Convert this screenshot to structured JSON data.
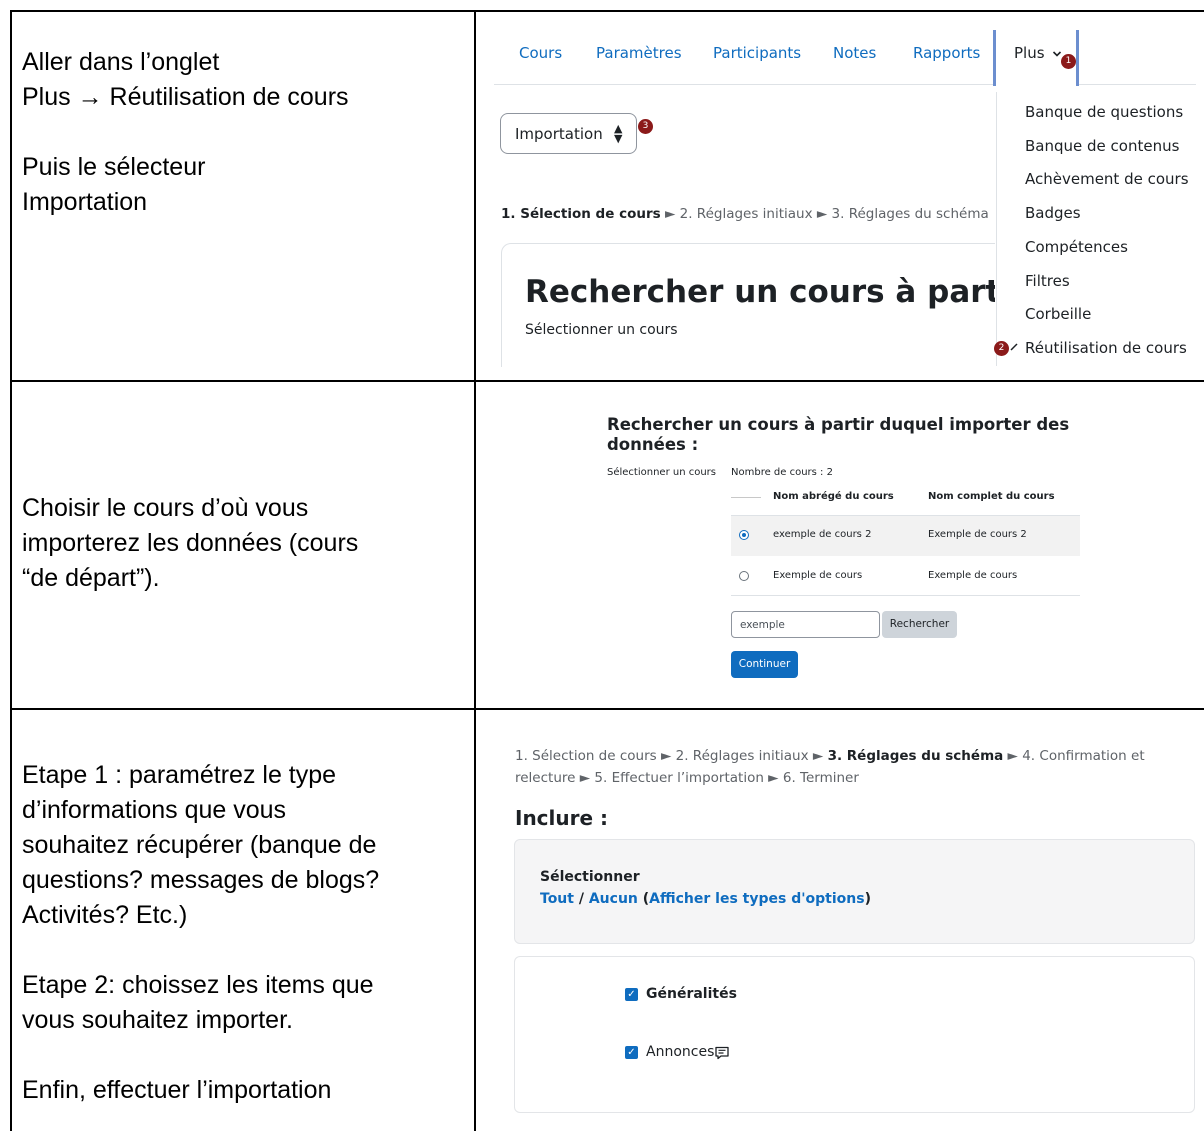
{
  "rows": [
    {
      "text": "Aller dans l’onglet\nPlus → Réutilisation de cours\n\nPuis le sélecteur\nImportation"
    },
    {
      "text": "Choisir le cours d’où vous\nimporterez les données (cours\n“de départ”)."
    },
    {
      "text": "Etape 1 : paramétrez le type\nd’informations que vous\nsouhaitez récupérer (banque de\nquestions? messages de blogs?\nActivités? Etc.)\n\nEtape 2: choissez les items que\nvous souhaitez importer.\n\nEnfin, effectuer l’importation"
    }
  ],
  "nav": {
    "tabs": [
      "Cours",
      "Paramètres",
      "Participants",
      "Notes",
      "Rapports"
    ],
    "more_label": "Plus",
    "more_items": [
      "Banque de questions",
      "Banque de contenus",
      "Achèvement de cours",
      "Badges",
      "Compétences",
      "Filtres",
      "Corbeille",
      "Réutilisation de cours"
    ]
  },
  "badges": {
    "one": "1",
    "two": "2",
    "three": "3"
  },
  "selector": {
    "value": "Importation"
  },
  "steps_top": {
    "current": "1. Sélection de cours",
    "rest": " ► 2. Réglages initiaux ► 3. Réglages du schéma"
  },
  "search_card": {
    "heading": "Rechercher un cours à partir duquel importer des données :",
    "sub": "Sélectionner un cours"
  },
  "course_search": {
    "title": "Rechercher un cours à partir duquel importer des données :",
    "label": "Sélectionner un cours",
    "count": "Nombre de cours : 2",
    "col_short": "Nom abrégé du cours",
    "col_full": "Nom complet du cours",
    "rows": [
      {
        "short": "exemple de cours 2",
        "full": "Exemple de cours 2",
        "selected": true
      },
      {
        "short": "Exemple de cours",
        "full": "Exemple de cours",
        "selected": false
      }
    ],
    "search_value": "exemple",
    "search_button": "Rechercher",
    "continue_button": "Continuer"
  },
  "steps_bottom": {
    "pre": "1. Sélection de cours ► 2. Réglages initiaux ► ",
    "current": "3. Réglages du schéma",
    "post": " ► 4. Confirmation et relecture ► 5. Effectuer l’importation ► 6. Terminer"
  },
  "include": {
    "heading": "Inclure :",
    "select_title": "Sélectionner",
    "all": "Tout",
    "sep": " / ",
    "none": "Aucun",
    "paren_open": " (",
    "show_types": "Afficher les types d'options",
    "paren_close": ")",
    "options": [
      {
        "label": "Généralités",
        "checked": true,
        "bold": true
      },
      {
        "label": "Annonces",
        "checked": true,
        "bold": false
      }
    ]
  },
  "colors": {
    "link": "#0f6cbf",
    "badge": "#8b1a1a"
  },
  "icons": {
    "checkbox": "checkbox-checked-icon",
    "forum": "forum-icon",
    "arrow": "arrow-right-icon"
  }
}
